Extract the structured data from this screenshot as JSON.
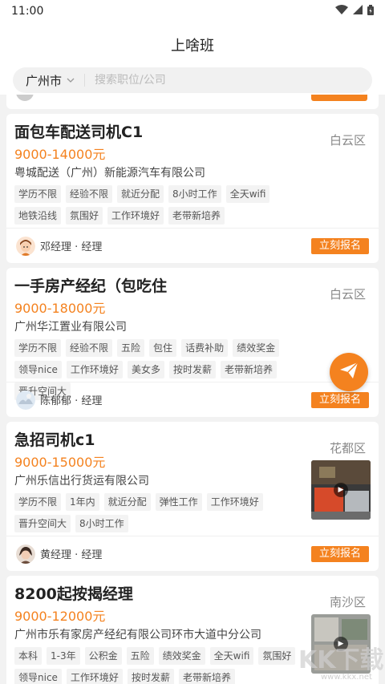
{
  "status_bar": {
    "time": "11:00"
  },
  "header": {
    "title": "上啥班"
  },
  "search": {
    "city": "广州市",
    "placeholder": "搜索职位/公司"
  },
  "colors": {
    "accent": "#f4821f",
    "salary": "#f4821f"
  },
  "jobs": [
    {
      "title": "面包车配送司机C1",
      "district": "白云区",
      "salary": "9000-14000元",
      "company": "粤城配送（广州）新能源汽车有限公司",
      "tags": [
        "学历不限",
        "经验不限",
        "就近分配",
        "8小时工作",
        "全天wifi",
        "地铁沿线",
        "氛围好",
        "工作环境好",
        "老带新培养"
      ],
      "recruiter": "邓经理 · 经理",
      "apply_label": "立刻报名"
    },
    {
      "title": "一手房产经纪（包吃住",
      "district": "白云区",
      "salary": "9000-18000元",
      "company": "广州华江置业有限公司",
      "tags": [
        "学历不限",
        "经验不限",
        "五险",
        "包住",
        "话费补助",
        "绩效奖金",
        "领导nice",
        "工作环境好",
        "美女多",
        "按时发薪",
        "老带新培养",
        "晋升空间大"
      ],
      "recruiter": "陈郁郁 · 经理",
      "apply_label": "立刻报名"
    },
    {
      "title": "急招司机c1",
      "district": "花都区",
      "salary": "9000-15000元",
      "company": "广州乐信出行货运有限公司",
      "tags": [
        "学历不限",
        "1年内",
        "就近分配",
        "弹性工作",
        "工作环境好",
        "晋升空间大",
        "8小时工作"
      ],
      "recruiter": "黄经理 · 经理",
      "apply_label": "立刻报名"
    },
    {
      "title": "8200起按揭经理",
      "district": "南沙区",
      "salary": "9000-12000元",
      "company": "广州市乐有家房产经纪有限公司环市大道中分公司",
      "tags": [
        "本科",
        "1-3年",
        "公积金",
        "五险",
        "绩效奖金",
        "全天wifi",
        "氛围好",
        "领导nice",
        "工作环境好",
        "按时发薪",
        "老带新培养"
      ],
      "recruiter": "",
      "apply_label": ""
    }
  ],
  "watermark": {
    "text": "KK下载",
    "url_text": "www.kkx.net"
  }
}
